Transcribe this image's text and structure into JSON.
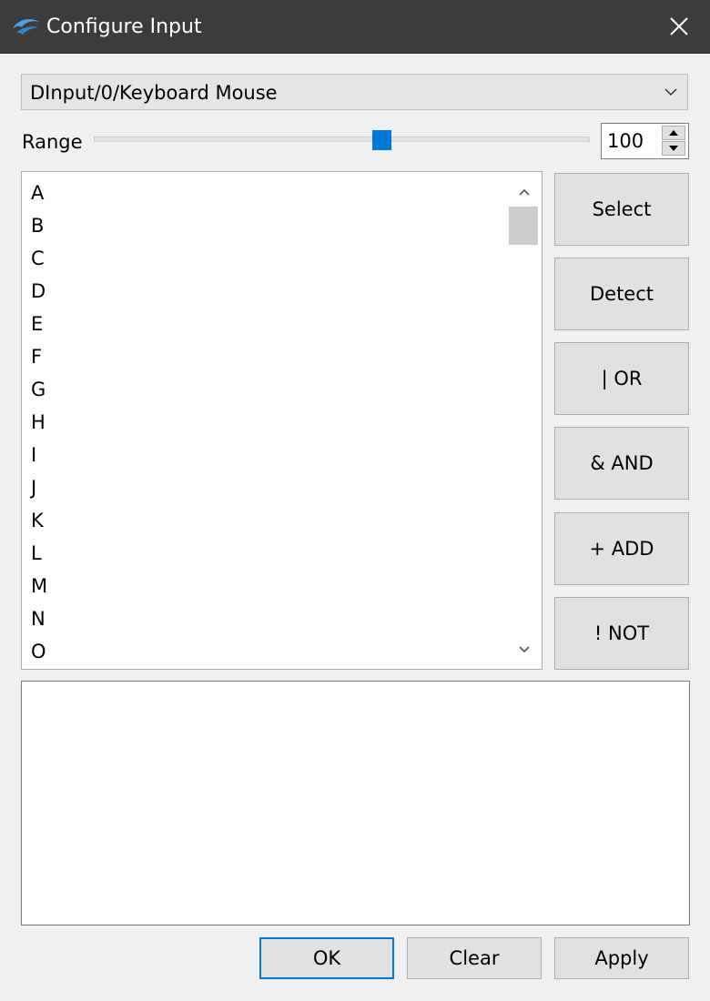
{
  "window": {
    "title": "Configure Input",
    "logo_icon": "dolphin-logo-icon",
    "close_icon": "close-icon"
  },
  "device": {
    "selected": "DInput/0/Keyboard Mouse"
  },
  "range": {
    "label": "Range",
    "value": "100",
    "slider_fraction": 0.58
  },
  "inputs": {
    "items": [
      "A",
      "B",
      "C",
      "D",
      "E",
      "F",
      "G",
      "H",
      "I",
      "J",
      "K",
      "L",
      "M",
      "N",
      "O"
    ]
  },
  "actions": {
    "select": "Select",
    "detect": "Detect",
    "or": "| OR",
    "and": "& AND",
    "add": "+ ADD",
    "not": "! NOT"
  },
  "expression": {
    "value": ""
  },
  "footer": {
    "ok": "OK",
    "clear": "Clear",
    "apply": "Apply"
  },
  "colors": {
    "titlebar": "#3c3c3c",
    "accent": "#0078d7",
    "background": "#f0f0f0"
  }
}
